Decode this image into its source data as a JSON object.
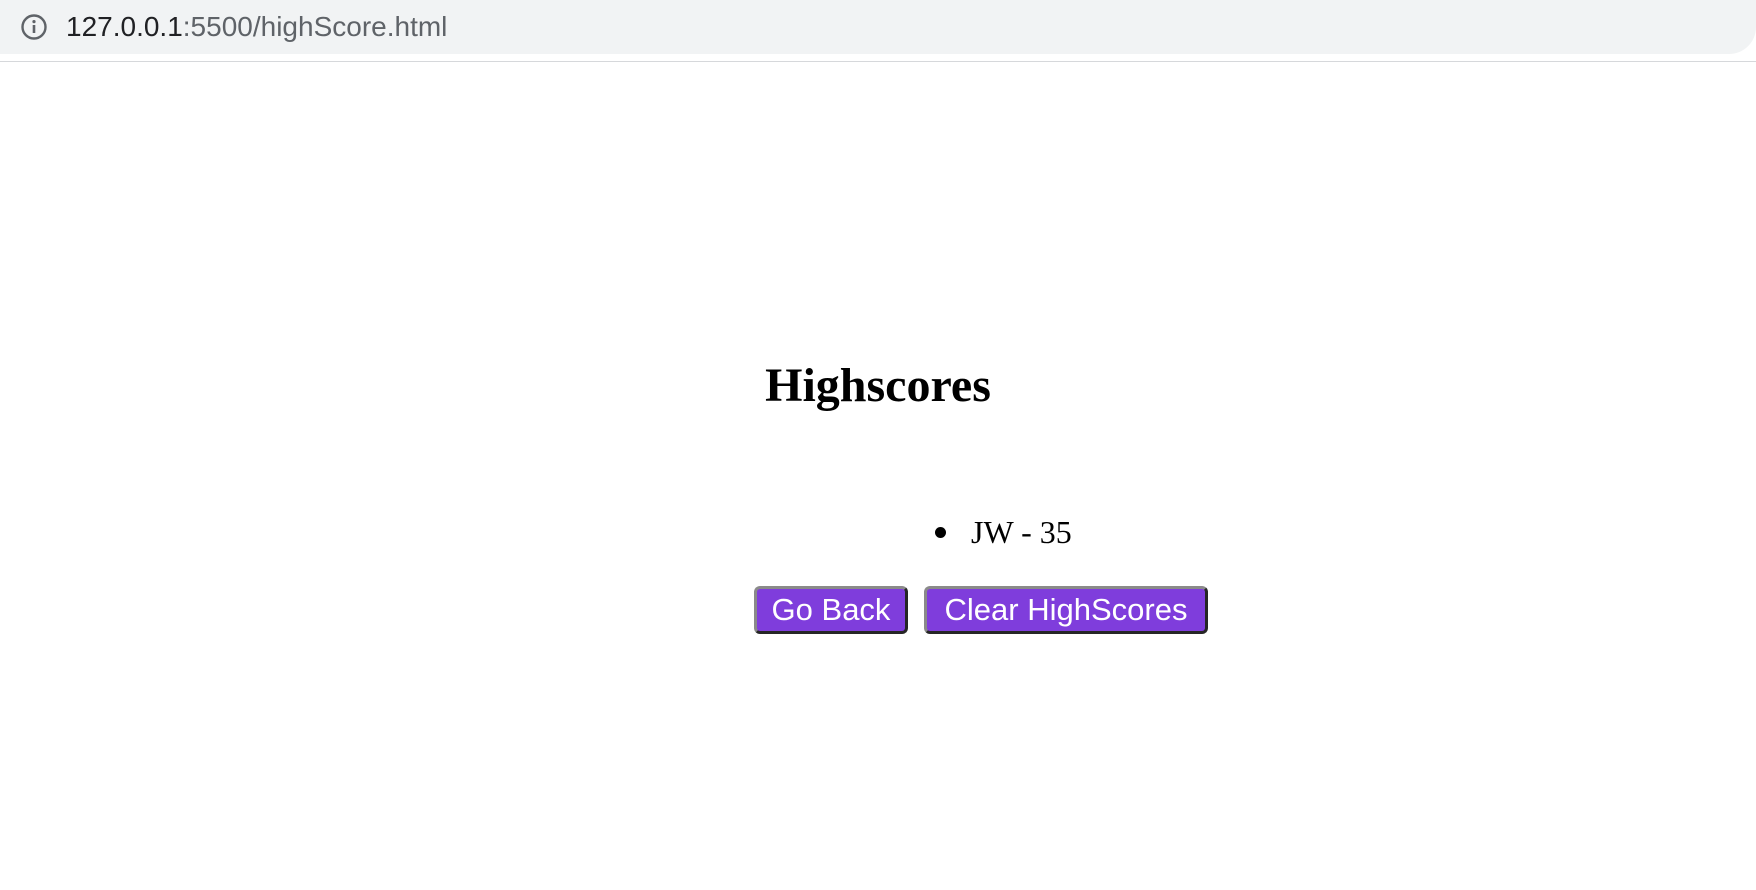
{
  "browser": {
    "url_host": "127.0.0.1",
    "url_path": ":5500/highScore.html",
    "info_icon": "info-icon"
  },
  "page": {
    "title": "Highscores",
    "scores": [
      {
        "text": "JW - 35"
      }
    ],
    "buttons": {
      "go_back": "Go Back",
      "clear": "Clear HighScores"
    }
  },
  "colors": {
    "button_background": "#7f3ddc",
    "button_text": "#ffffff",
    "address_bar": "#f1f3f4"
  }
}
